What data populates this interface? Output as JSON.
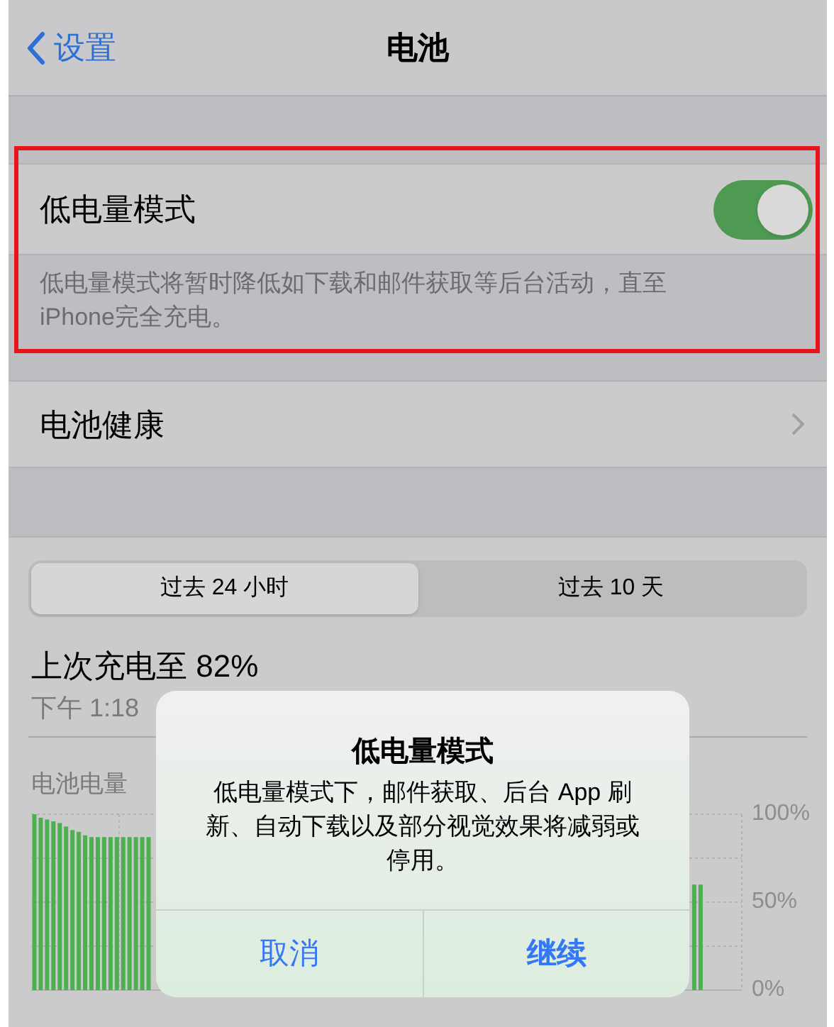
{
  "nav": {
    "back_label": "设置",
    "title": "电池"
  },
  "low_power": {
    "label": "低电量模式",
    "on": true,
    "footer": "低电量模式将暂时降低如下载和邮件获取等后台活动，直至iPhone完全充电。"
  },
  "battery_health": {
    "label": "电池健康"
  },
  "segments": [
    {
      "label": "过去 24 小时",
      "selected": true
    },
    {
      "label": "过去 10 天",
      "selected": false
    }
  ],
  "last_charge": {
    "title": "上次充电至 82%",
    "time": "下午 1:18"
  },
  "chart": {
    "chart_data": {
      "type": "bar",
      "title": "电池电量",
      "ylim": [
        0,
        100
      ],
      "yticks": [
        {
          "value": 0,
          "label": "0%"
        },
        {
          "value": 50,
          "label": "50%"
        },
        {
          "value": 100,
          "label": "100%"
        }
      ],
      "values": [
        100,
        98,
        97,
        96,
        95,
        93,
        91,
        90,
        88,
        87,
        87,
        87,
        87,
        87,
        87,
        87,
        87,
        87,
        87,
        null,
        null,
        null,
        null,
        null,
        null,
        null,
        null,
        null,
        null,
        null,
        null,
        null,
        null,
        null,
        null,
        null,
        null,
        null,
        null,
        null,
        null,
        null,
        null,
        null,
        null,
        null,
        null,
        null,
        null,
        null,
        null,
        null,
        null,
        null,
        null,
        null,
        null,
        null,
        null,
        null,
        null,
        null,
        null,
        null,
        null,
        null,
        null,
        null,
        null,
        null,
        null,
        null,
        null,
        null,
        null,
        null,
        null,
        null,
        null,
        null,
        null,
        null,
        null,
        null,
        null,
        null,
        null,
        null,
        null,
        null,
        null,
        null,
        null,
        null,
        null,
        null,
        null,
        null,
        null,
        null,
        null,
        null,
        null,
        null,
        60,
        60,
        null,
        null,
        null,
        null,
        null,
        null
      ]
    }
  },
  "alert": {
    "title": "低电量模式",
    "message": "低电量模式下，邮件获取、后台 App 刷新、自动下载以及部分视觉效果将减弱或停用。",
    "buttons": [
      {
        "label": "取消",
        "kind": "cancel"
      },
      {
        "label": "继续",
        "kind": "confirm"
      }
    ]
  }
}
